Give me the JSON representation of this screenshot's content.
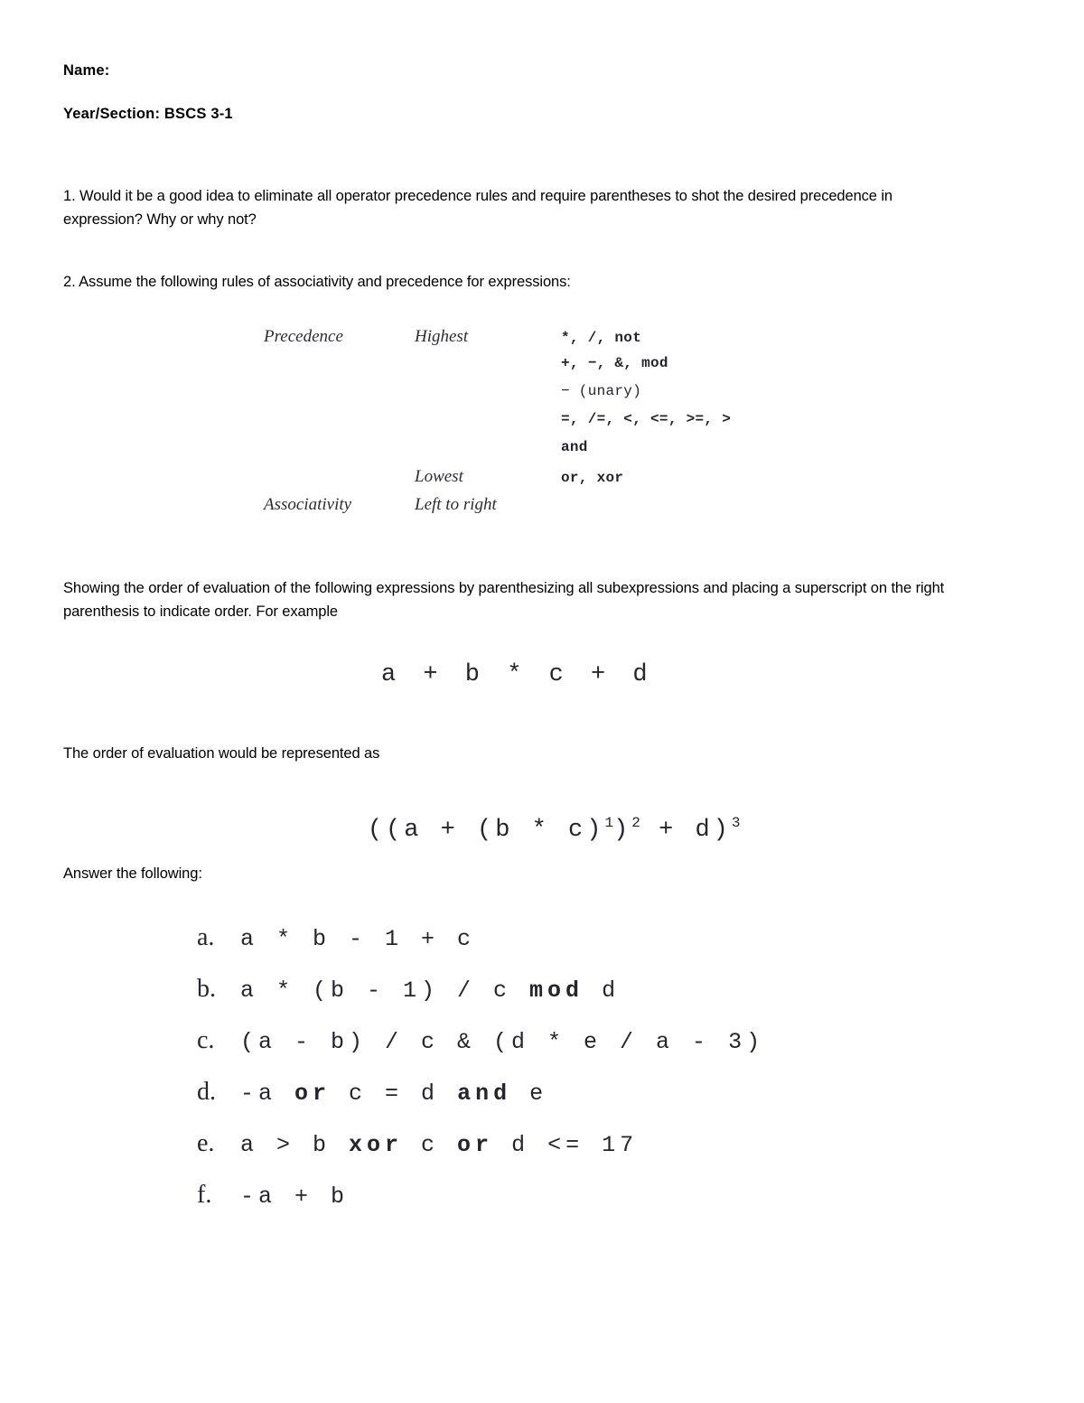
{
  "document": {
    "header": {
      "name_label": "Name:",
      "name_value": "",
      "year_section_label": "Year/Section:",
      "year_section_value": "BSCS 3-1",
      "year_section_line": "Year/Section: BSCS 3-1"
    },
    "questions": {
      "q1": "1. Would it be a good idea to eliminate all operator precedence rules and require parentheses to shot the desired precedence in expression? Why or why not?",
      "q2": "2. Assume the following rules of associativity and precedence for expressions:"
    },
    "precedence_table": {
      "rows": [
        {
          "label": "Precedence",
          "rank": "Highest",
          "ops": "*, /, not"
        },
        {
          "label": "",
          "rank": "",
          "ops": "+, −, &, mod"
        },
        {
          "label": "",
          "rank": "",
          "ops": "− (unary)"
        },
        {
          "label": "",
          "rank": "",
          "ops": "=, /=, <, <=, >=, >"
        },
        {
          "label": "",
          "rank": "",
          "ops": "and"
        },
        {
          "label": "",
          "rank": "Lowest",
          "ops": "or, xor"
        },
        {
          "label": "Associativity",
          "rank": "Left to right",
          "ops": ""
        }
      ]
    },
    "instructions": {
      "showing": "Showing the order of evaluation of the following expressions by parenthesizing all subexpressions and placing a superscript on the right parenthesis to indicate order. For example",
      "order_line": "The order of evaluation would be represented as",
      "answer_line": "Answer the following:"
    },
    "example_expression": "a + b * c + d",
    "example_parenthesized": {
      "p1": "((a + (b * c)",
      "sup1": "1",
      "p2": ")",
      "sup2": "2",
      "p3": " + d)",
      "sup3": "3"
    },
    "answers": [
      {
        "marker": "a.",
        "expr_html": "a * b - 1 + c",
        "expr": "a * b - 1 + c"
      },
      {
        "marker": "b.",
        "expr_html": "a * (b - 1) / c <b>mod</b> d",
        "expr": "a * (b - 1) / c mod d"
      },
      {
        "marker": "c.",
        "expr_html": "(a - b) / c & (d * e / a - 3)",
        "expr": "(a - b) / c & (d * e / a - 3)"
      },
      {
        "marker": "d.",
        "expr_html": "-a <b>or</b> c = d <b>and</b> e",
        "expr": "-a or c = d and e"
      },
      {
        "marker": "e.",
        "expr_html": "a > b <b>xor</b> c <b>or</b> d <= 17",
        "expr": "a > b xor c or d <= 17"
      },
      {
        "marker": "f.",
        "expr_html": "-a + b",
        "expr": "-a + b"
      }
    ],
    "colors": {
      "page_background": "#ffffff",
      "text": "#000000",
      "serif_text": "#2c2c33",
      "mono_text": "#25252c"
    }
  }
}
